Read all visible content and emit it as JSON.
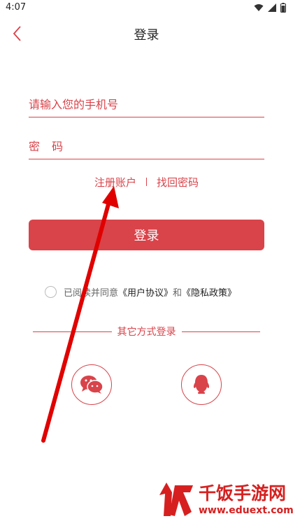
{
  "status_bar": {
    "time": "4:07"
  },
  "header": {
    "title": "登录"
  },
  "form": {
    "phone_placeholder": "请输入您的手机号",
    "password_placeholder": "密 码"
  },
  "links": {
    "register": "注册账户",
    "forgot": "找回密码"
  },
  "login_button": "登录",
  "agreement": {
    "prefix": "已阅读并同意",
    "user_agreement": "《用户协议》",
    "and": "和",
    "privacy_policy": "《隐私政策》"
  },
  "other_login": {
    "label": "其它方式登录",
    "options": [
      {
        "icon": "wechat-icon"
      },
      {
        "icon": "qq-icon"
      }
    ]
  },
  "watermark": {
    "name": "千饭手游网",
    "url": "www.eduext.com"
  },
  "colors": {
    "accent": "#d9434a",
    "annotation": "#e00000"
  }
}
